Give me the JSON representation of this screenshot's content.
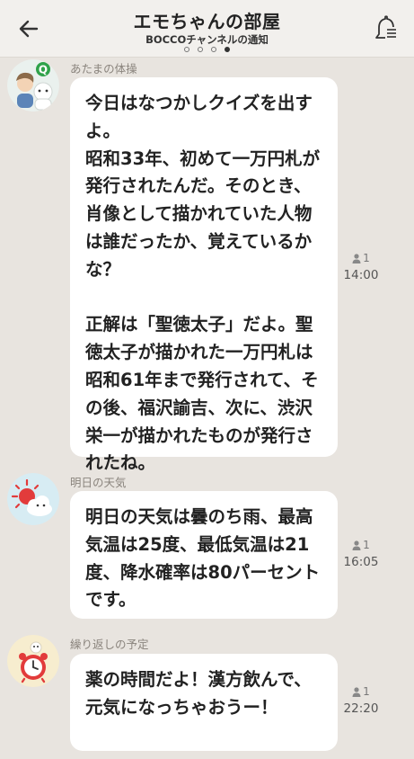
{
  "header": {
    "title": "エモちゃんの部屋",
    "subtitle": "BOCCOチャンネルの通知",
    "page_dots": 4,
    "active_dot": 3
  },
  "messages": [
    {
      "sender": "あたまの体操",
      "avatar_icon": "quiz-character-icon",
      "text": "今日はなつかしクイズを出すよ。\n昭和33年、初めて一万円札が発行されたんだ。そのとき、肖像として描かれていた人物は誰だったか、覚えているかな？\n\n正解は「聖徳太子」だよ。聖徳太子が描かれた一万円札は昭和61年まで発行されて、その後、福沢諭吉、次に、渋沢栄一が描かれたものが発行されたね。",
      "read_count": "1",
      "time": "14:00"
    },
    {
      "sender": "明日の天気",
      "avatar_icon": "weather-sun-cloud-icon",
      "text": "明日の天気は曇のち雨、最高気温は25度、最低気温は21度、降水確率は80パーセントです。",
      "read_count": "1",
      "time": "16:05"
    },
    {
      "sender": "繰り返しの予定",
      "avatar_icon": "alarm-clock-icon",
      "text": "薬の時間だよ！漢方飲んで、元気になっちゃおうー！",
      "read_count": "1",
      "time": "22:20"
    }
  ],
  "colors": {
    "background": "#e8e4df",
    "header_bg": "#f2f0ed",
    "bubble_bg": "#ffffff",
    "sender_text": "#8a847d"
  }
}
